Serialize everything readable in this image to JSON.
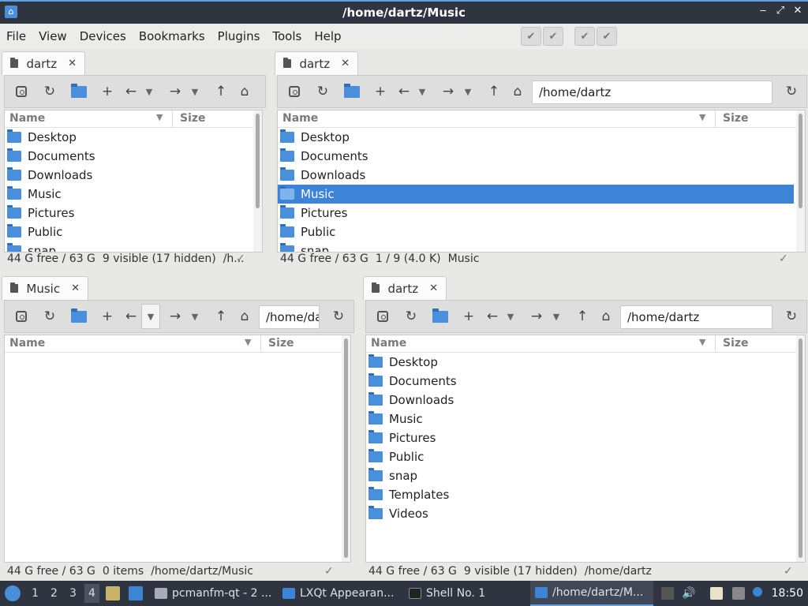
{
  "window": {
    "title": "/home/dartz/Music"
  },
  "menu": [
    "File",
    "View",
    "Devices",
    "Bookmarks",
    "Plugins",
    "Tools",
    "Help"
  ],
  "list_header": {
    "name": "Name",
    "size": "Size"
  },
  "pane_tl": {
    "tab": "dartz",
    "files": [
      "Desktop",
      "Documents",
      "Downloads",
      "Music",
      "Pictures",
      "Public",
      "snap"
    ],
    "status": {
      "free": "44 G free / 63 G",
      "info": "9 visible (17 hidden)",
      "path": "/h..."
    }
  },
  "pane_tr": {
    "tab": "dartz",
    "path": "/home/dartz",
    "files": [
      "Desktop",
      "Documents",
      "Downloads",
      "Music",
      "Pictures",
      "Public",
      "snap"
    ],
    "selected": "Music",
    "status": {
      "free": "44 G free / 63 G",
      "info": "1 / 9 (4.0 K)",
      "path": "Music"
    }
  },
  "pane_bl": {
    "tab": "Music",
    "path": "/home/dartz/Music",
    "files": [],
    "status": {
      "free": "44 G free / 63 G",
      "info": "0 items",
      "path": "/home/dartz/Music"
    }
  },
  "pane_br": {
    "tab": "dartz",
    "path": "/home/dartz",
    "files": [
      "Desktop",
      "Documents",
      "Downloads",
      "Music",
      "Pictures",
      "Public",
      "snap",
      "Templates",
      "Videos"
    ],
    "status": {
      "free": "44 G free / 63 G",
      "info": "9 visible (17 hidden)",
      "path": "/home/dartz"
    }
  },
  "taskbar": {
    "desktops": [
      "1",
      "2",
      "3",
      "4"
    ],
    "tasks": [
      "pcmanfm-qt - 2 ...",
      "LXQt Appearan...",
      "Shell No. 1",
      "/home/dartz/M..."
    ],
    "clock": "18:50"
  },
  "colors": {
    "accent": "#3d83d6",
    "folder": "#4a8fdc",
    "titlebar": "#2e3440"
  }
}
